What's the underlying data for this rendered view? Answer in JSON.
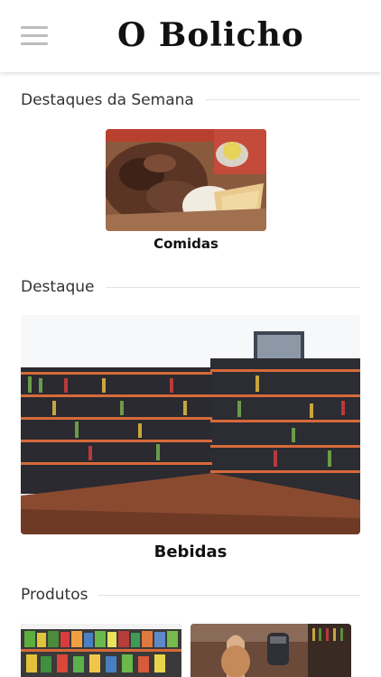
{
  "header": {
    "brand": "O Bolicho",
    "menu_icon": "hamburger-menu-icon"
  },
  "weekly_highlights": {
    "title": "Destaques da Semana",
    "items": [
      {
        "label": "Comidas"
      }
    ]
  },
  "featured": {
    "title": "Destaque",
    "items": [
      {
        "label": "Bebidas"
      }
    ]
  },
  "products": {
    "title": "Produtos"
  },
  "colors": {
    "accent_line": "#e2e2e2",
    "menu_icon": "#bdbdbd",
    "text": "#222222"
  }
}
